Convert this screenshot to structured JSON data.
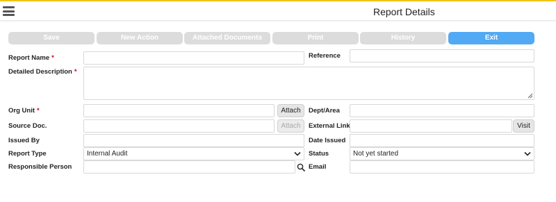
{
  "header": {
    "title": "Report Details",
    "menu_icon": "hamburger-menu-icon"
  },
  "toolbar": {
    "buttons": [
      "Save",
      "New Action",
      "Attached Documents",
      "Print",
      "History",
      "Exit"
    ],
    "accent": "#52a9f4"
  },
  "form": {
    "report_name": {
      "label": "Report Name",
      "required": "*",
      "value": ""
    },
    "reference": {
      "label": "Reference",
      "value": ""
    },
    "detailed_description": {
      "label": "Detailed Description",
      "required": "*",
      "value": ""
    },
    "org_unit": {
      "label": "Org Unit",
      "required": "*",
      "value": "",
      "button": "Attach"
    },
    "dept_area": {
      "label": "Dept/Area",
      "value": ""
    },
    "source_doc": {
      "label": "Source Doc.",
      "value": "",
      "button": "Attach"
    },
    "external_link": {
      "label": "External Link",
      "value": "",
      "button": "Visit"
    },
    "issued_by": {
      "label": "Issued By",
      "value": ""
    },
    "date_issued": {
      "label": "Date Issued",
      "value": ""
    },
    "report_type": {
      "label": "Report Type",
      "selected": "Internal Audit"
    },
    "status": {
      "label": "Status",
      "selected": "Not yet started"
    },
    "responsible_person": {
      "label": "Responsible Person",
      "value": "",
      "icon": "search-icon"
    },
    "email": {
      "label": "Email",
      "value": ""
    }
  },
  "colors": {
    "required": "#d0021b",
    "top_border": "#f0c419",
    "disabled_button": "#dcdcdc"
  }
}
